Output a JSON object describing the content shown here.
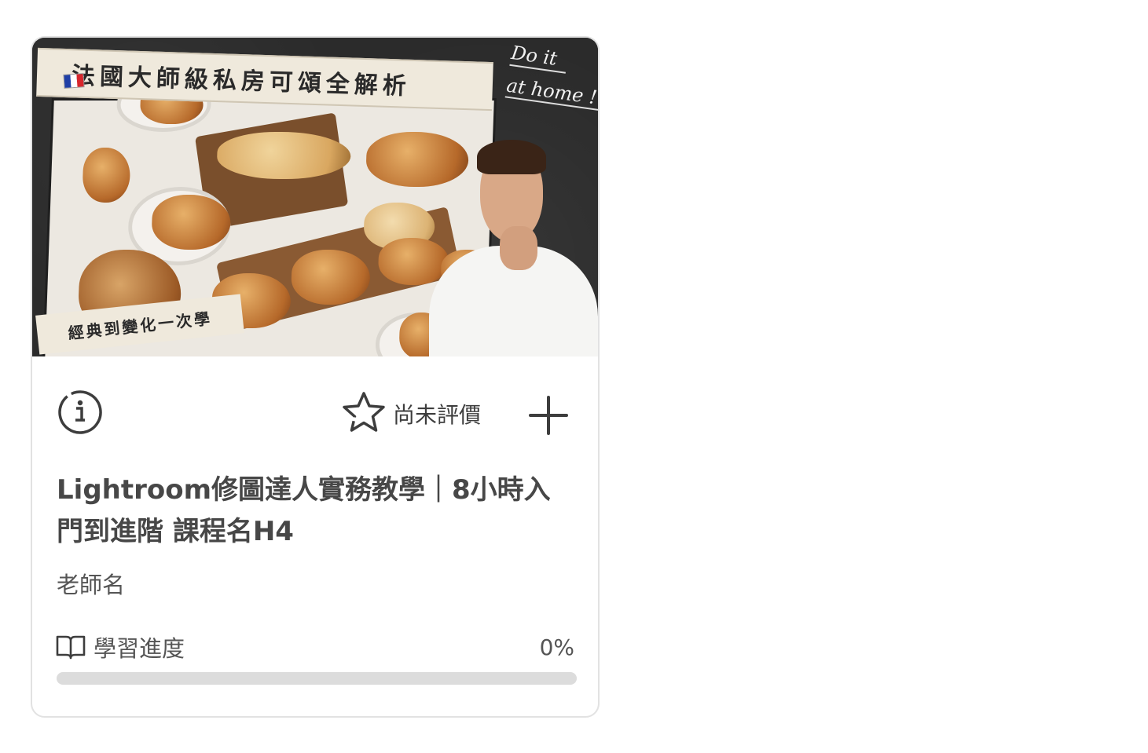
{
  "course": {
    "cover": {
      "banner_title": "法國大師級私房可頌全解析",
      "banner_subtitle": "經典到變化一次學",
      "tagline_line1": "Do it",
      "tagline_line2": "at home !"
    },
    "rating_text": "尚未評價",
    "title": "Lightroom修圖達人實務教學｜8小時入門到進階 課程名H4",
    "teacher": "老師名",
    "progress": {
      "label": "學習進度",
      "percent_text": "0%",
      "value": 0
    }
  },
  "colors": {
    "text": "#474747",
    "border": "#e2e2e2",
    "track": "#dcdcdc"
  },
  "icons": [
    "info-icon",
    "star-icon",
    "plus-icon",
    "book-icon",
    "france-flag-icon"
  ]
}
